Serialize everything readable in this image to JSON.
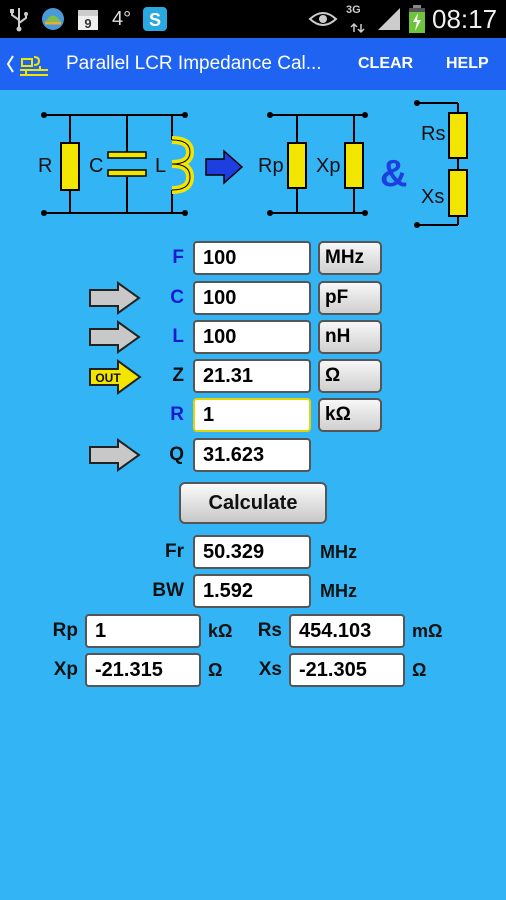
{
  "status_bar": {
    "temperature": "4°",
    "calendar_day": "9",
    "network": "3G",
    "time": "08:17"
  },
  "action_bar": {
    "title": "Parallel LCR Impedance Cal...",
    "clear_label": "CLEAR",
    "help_label": "HELP"
  },
  "diagram": {
    "left_labels": [
      "R",
      "C",
      "L"
    ],
    "right_labels": [
      "Rp",
      "Xp"
    ],
    "ampersand": "&",
    "series_labels": [
      "Rs",
      "Xs"
    ]
  },
  "inputs": [
    {
      "label": "F",
      "value": "100",
      "unit": "MHz",
      "indicator": "none"
    },
    {
      "label": "C",
      "value": "100",
      "unit": "pF",
      "indicator": "arrow"
    },
    {
      "label": "L",
      "value": "100",
      "unit": "nH",
      "indicator": "arrow"
    },
    {
      "label": "Z",
      "value": "21.31",
      "unit": "Ω",
      "indicator": "out"
    },
    {
      "label": "R",
      "value": "1",
      "unit": "kΩ",
      "indicator": "none"
    },
    {
      "label": "Q",
      "value": "31.623",
      "unit": "",
      "indicator": "arrow"
    }
  ],
  "out_badge": "OUT",
  "calculate_label": "Calculate",
  "results": {
    "fr": {
      "label": "Fr",
      "value": "50.329",
      "unit": "MHz"
    },
    "bw": {
      "label": "BW",
      "value": "1.592",
      "unit": "MHz"
    },
    "rp": {
      "label": "Rp",
      "value": "1",
      "unit": "kΩ"
    },
    "rs": {
      "label": "Rs",
      "value": "454.103",
      "unit": "mΩ"
    },
    "xp": {
      "label": "Xp",
      "value": "-21.315",
      "unit": "Ω"
    },
    "xs": {
      "label": "Xs",
      "value": "-21.305",
      "unit": "Ω"
    }
  },
  "colors": {
    "background": "#33B5F5",
    "action_bar": "#1E63F2",
    "component_yellow": "#F2E600",
    "label_blue": "#1A1AD0"
  }
}
